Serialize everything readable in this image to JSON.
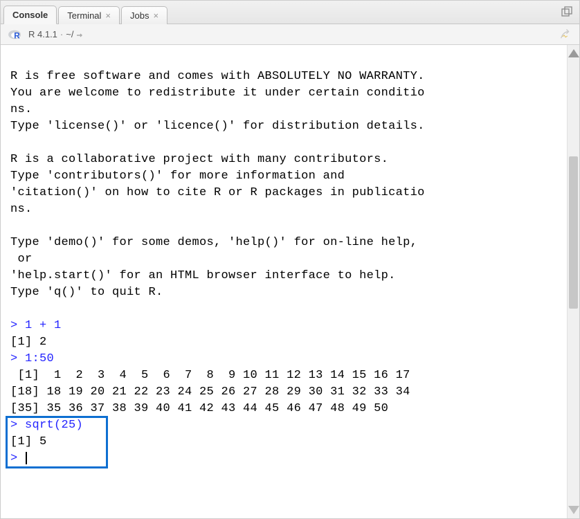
{
  "tabs": {
    "console": "Console",
    "terminal": "Terminal",
    "jobs": "Jobs"
  },
  "toolbar": {
    "version": "R 4.1.1",
    "separator": "·",
    "wd": "~/"
  },
  "console": {
    "intro": [
      "",
      "R is free software and comes with ABSOLUTELY NO WARRANTY.",
      "You are welcome to redistribute it under certain conditio",
      "ns.",
      "Type 'license()' or 'licence()' for distribution details.",
      "",
      "R is a collaborative project with many contributors.",
      "Type 'contributors()' for more information and",
      "'citation()' on how to cite R or R packages in publicatio",
      "ns.",
      "",
      "Type 'demo()' for some demos, 'help()' for on-line help,",
      " or",
      "'help.start()' for an HTML browser interface to help.",
      "Type 'q()' to quit R.",
      ""
    ],
    "entries": [
      {
        "prompt": ">",
        "input": "1 + 1",
        "output": [
          "[1] 2"
        ]
      },
      {
        "prompt": ">",
        "input": "1:50",
        "output": [
          " [1]  1  2  3  4  5  6  7  8  9 10 11 12 13 14 15 16 17",
          "[18] 18 19 20 21 22 23 24 25 26 27 28 29 30 31 32 33 34",
          "[35] 35 36 37 38 39 40 41 42 43 44 45 46 47 48 49 50"
        ]
      },
      {
        "prompt": ">",
        "input": "sqrt(25)",
        "output": [
          "[1] 5"
        ]
      }
    ],
    "current_prompt": ">"
  }
}
